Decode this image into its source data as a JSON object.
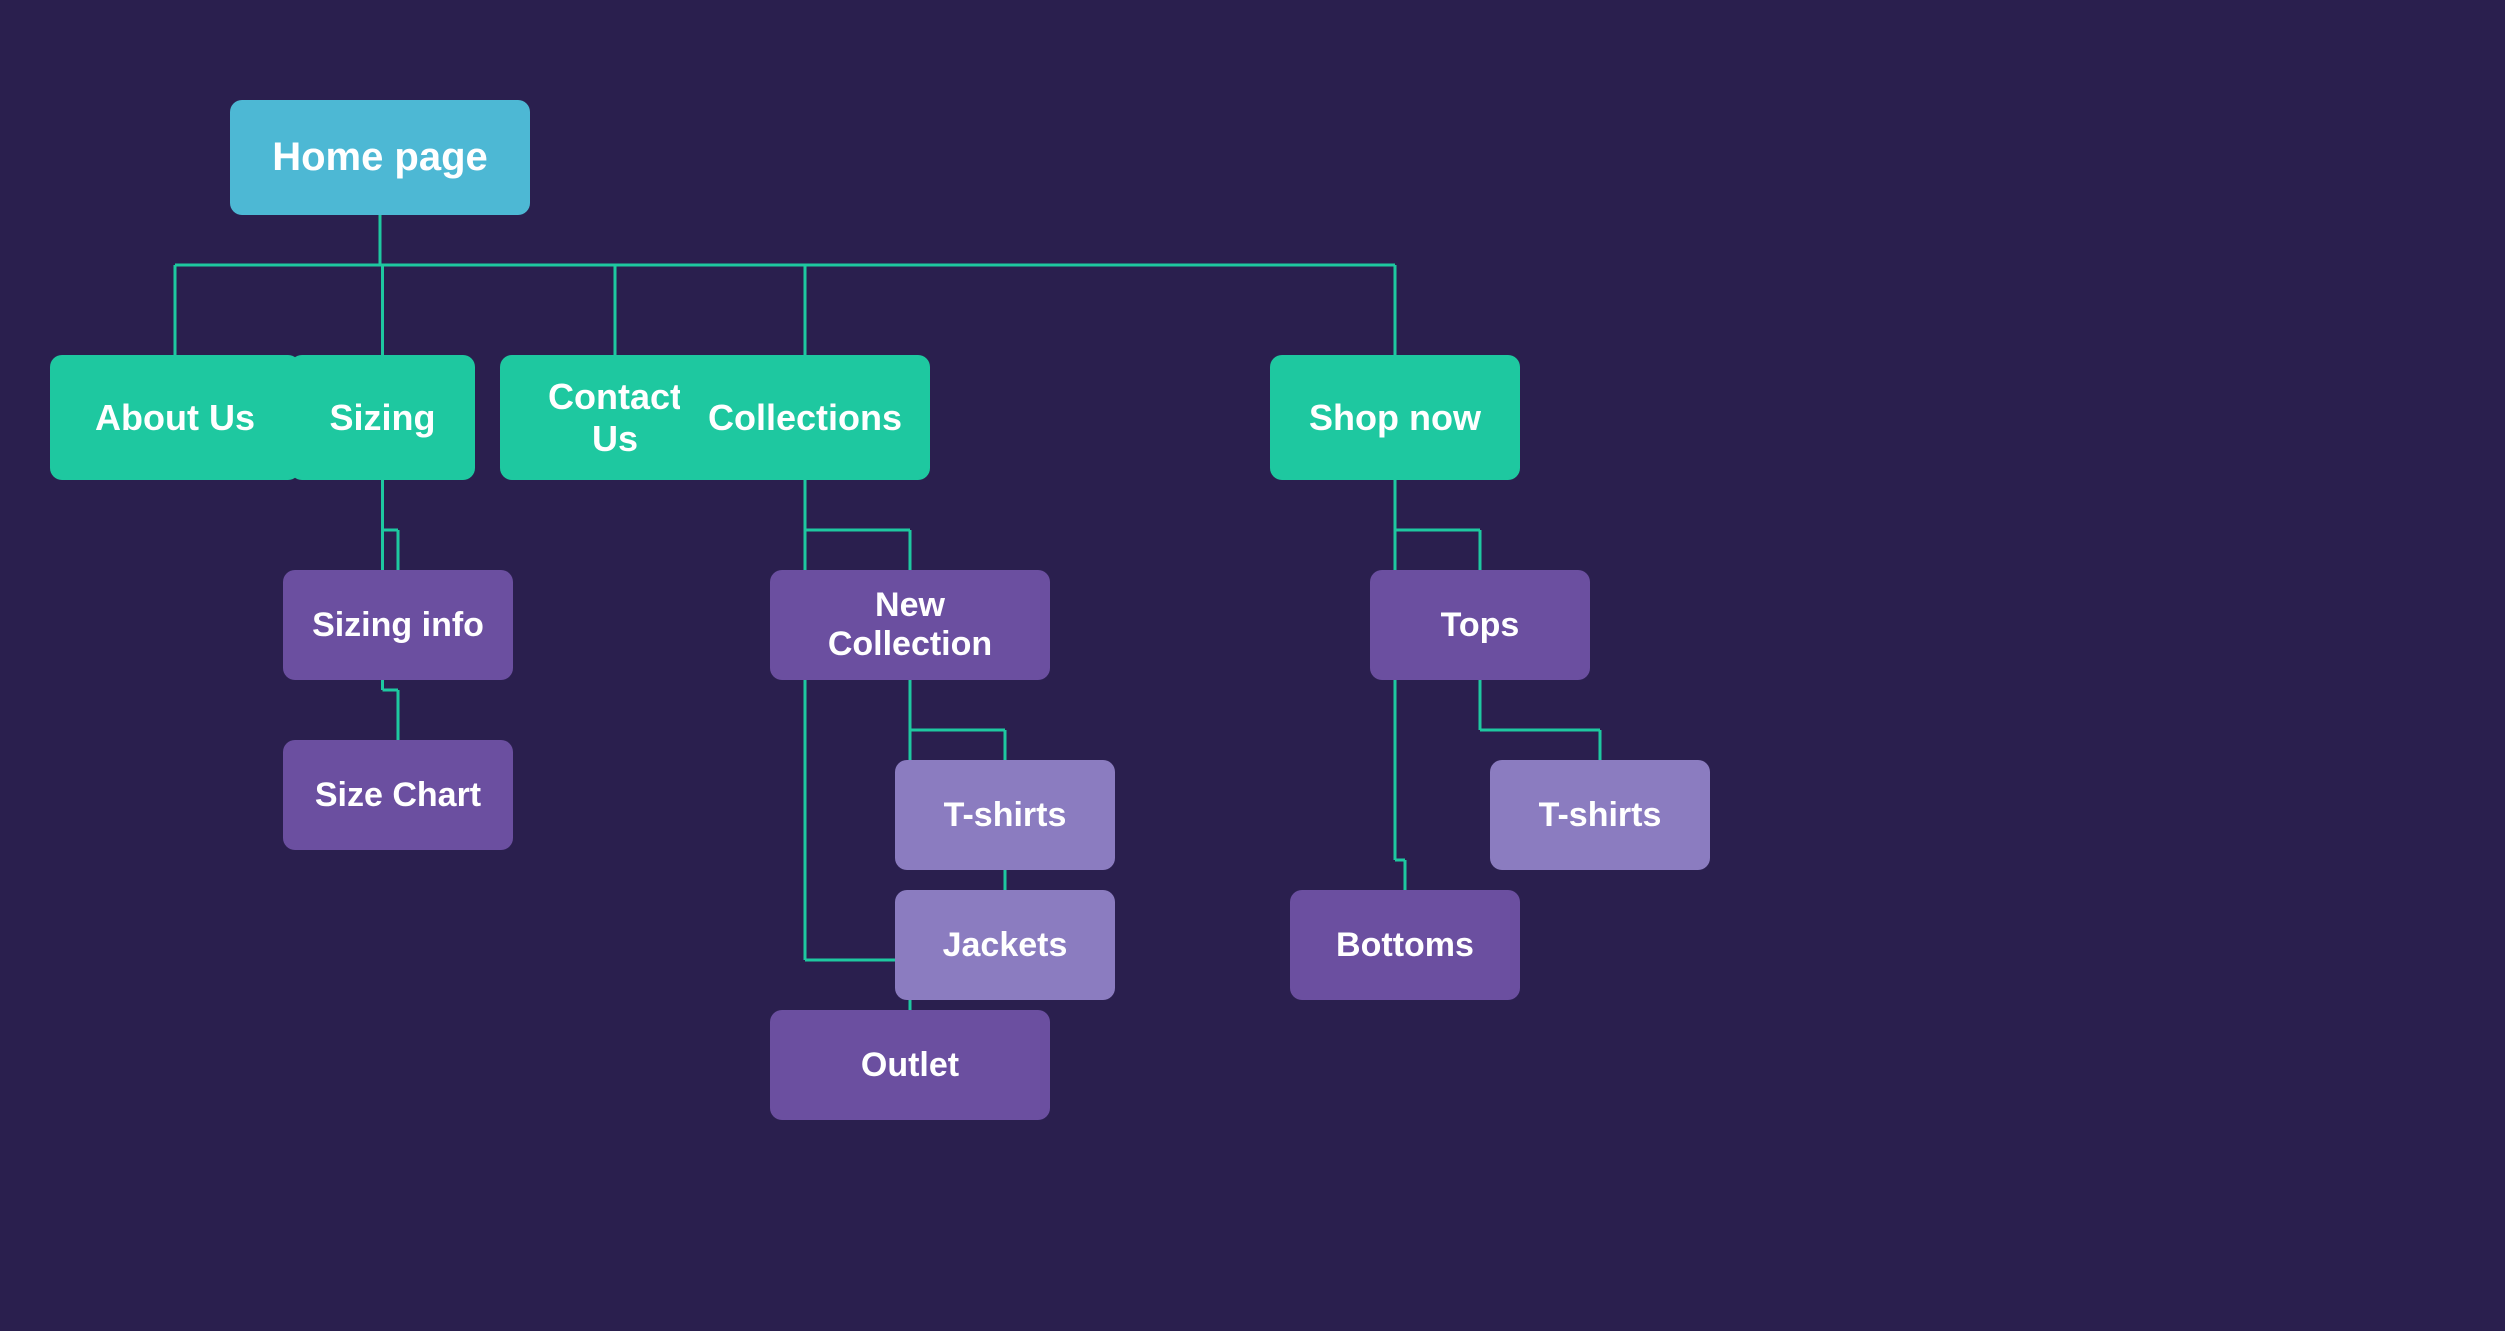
{
  "nodes": {
    "home_page": {
      "label": "Home page"
    },
    "about_us": {
      "label": "About Us"
    },
    "sizing": {
      "label": "Sizing"
    },
    "contact_us": {
      "label": "Contact Us"
    },
    "collections": {
      "label": "Collections"
    },
    "shop_now": {
      "label": "Shop now"
    },
    "sizing_info": {
      "label": "Sizing info"
    },
    "size_chart": {
      "label": "Size Chart"
    },
    "new_collection": {
      "label": "New Collection"
    },
    "tshirts_collections": {
      "label": "T-shirts"
    },
    "jackets": {
      "label": "Jackets"
    },
    "outlet": {
      "label": "Outlet"
    },
    "tops": {
      "label": "Tops"
    },
    "tshirts_shop": {
      "label": "T-shirts"
    },
    "bottoms": {
      "label": "Bottoms"
    }
  },
  "colors": {
    "bg": "#2a1f4e",
    "blue": "#4db8d4",
    "teal": "#1ec8a0",
    "purple_dark": "#6b4fa0",
    "purple_medium": "#7b5db8",
    "purple_light": "#8b7cc0",
    "line": "#1ec8a0"
  }
}
